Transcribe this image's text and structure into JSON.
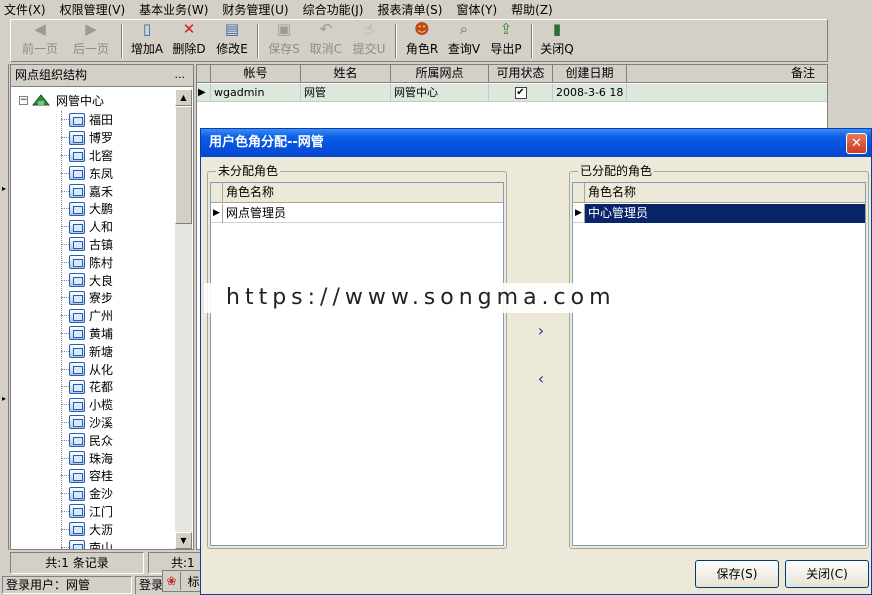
{
  "menu": [
    {
      "label": "文件(X)"
    },
    {
      "label": "权限管理(V)"
    },
    {
      "label": "基本业务(W)"
    },
    {
      "label": "财务管理(U)"
    },
    {
      "label": "综合功能(J)"
    },
    {
      "label": "报表清单(S)"
    },
    {
      "label": "窗体(Y)"
    },
    {
      "label": "帮助(Z)"
    }
  ],
  "toolbar": {
    "prev": "前一页",
    "next": "后一页",
    "add": "增加A",
    "delete": "删除D",
    "edit": "修改E",
    "save": "保存S",
    "cancel": "取消C",
    "submit": "提交U",
    "role": "角色R",
    "query": "查询V",
    "export": "导出P",
    "close": "关闭Q"
  },
  "left_panel": {
    "title": "网点组织结构",
    "more": "...",
    "root": "网管中心",
    "items": [
      "福田",
      "博罗",
      "北窖",
      "东凤",
      "嘉禾",
      "大鹏",
      "人和",
      "古镇",
      "陈村",
      "大良",
      "寮步",
      "广州",
      "黄埔",
      "新塘",
      "从化",
      "花都",
      "小榄",
      "沙溪",
      "民众",
      "珠海",
      "容桂",
      "金沙",
      "江门",
      "大沥",
      "南山"
    ]
  },
  "grid": {
    "columns": [
      "帐号",
      "姓名",
      "所属网点",
      "可用状态",
      "创建日期",
      "备注"
    ],
    "rows": [
      {
        "account": "wgadmin",
        "name": "网管",
        "branch": "网管中心",
        "enabled": "✔",
        "created": "2008-3-6 18",
        "note": ""
      }
    ]
  },
  "status": {
    "record_count": "共:1 条记录",
    "record_count2": "共:1",
    "user": "登录用户：网管",
    "user2": "登录",
    "ime_mode": "标准"
  },
  "dialog": {
    "title": "用户色角分配--网管",
    "unassigned_title": "未分配角色",
    "assigned_title": "已分配的角色",
    "column": "角色名称",
    "unassigned_roles": [
      "网点管理员"
    ],
    "assigned_roles": [
      "中心管理员"
    ],
    "add_arrow": "›",
    "remove_arrow": "‹",
    "save_button": "保存(S)",
    "close_button": "关闭(C)"
  },
  "watermark": "https://www.songma.com",
  "colors": {
    "title_bar": "#0a5ce6",
    "selection": "#0a246a",
    "grid_row": "#dbe8db",
    "close_button": "#cc3b1c"
  }
}
